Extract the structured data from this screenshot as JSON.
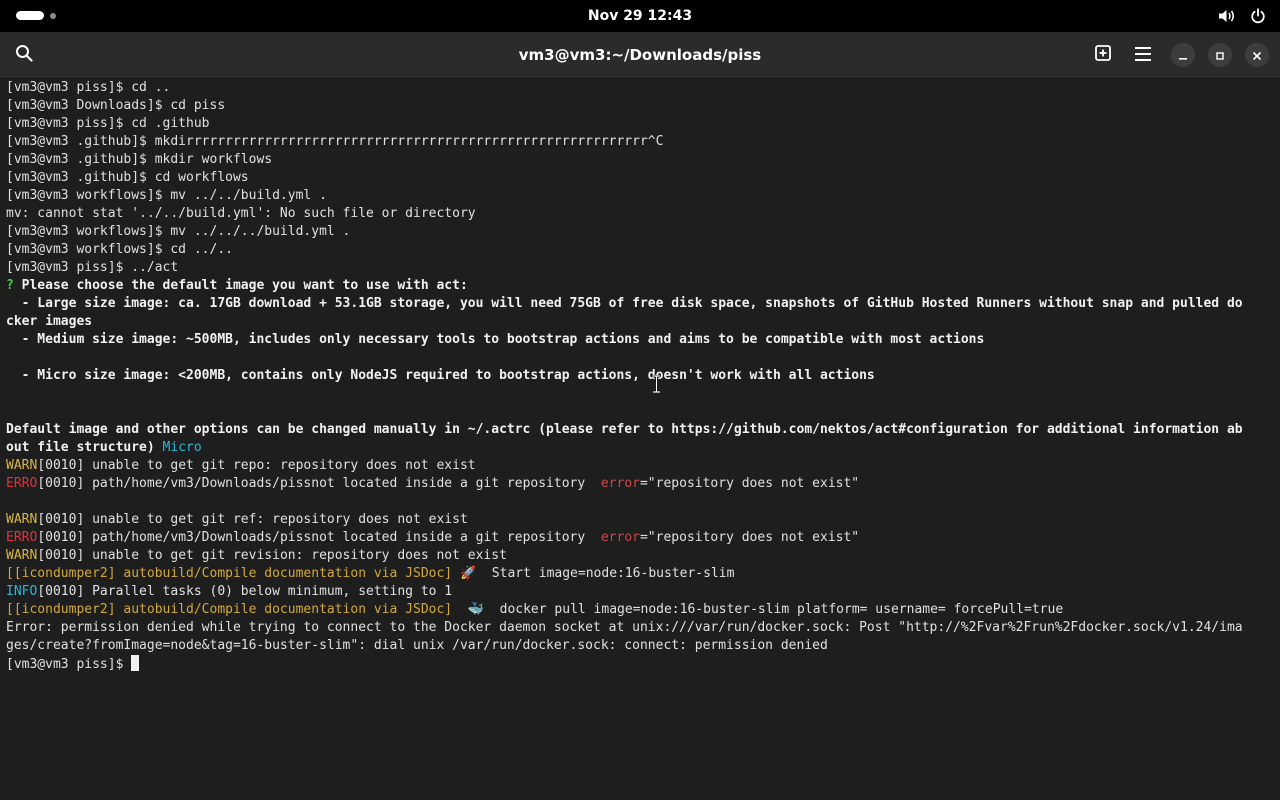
{
  "topbar": {
    "datetime": "Nov 29  12:43",
    "icons": [
      "activities-indicator",
      "volume-icon",
      "power-icon"
    ]
  },
  "window": {
    "title": "vm3@vm3:~/Downloads/piss",
    "icons": [
      "search-icon",
      "new-tab-icon",
      "menu-icon",
      "minimize-icon",
      "maximize-icon",
      "close-icon"
    ]
  },
  "terminal": {
    "l1": "[vm3@vm3 piss]$ cd ..",
    "l2": "[vm3@vm3 Downloads]$ cd piss",
    "l3": "[vm3@vm3 piss]$ cd .github",
    "l4": "[vm3@vm3 .github]$ mkdirrrrrrrrrrrrrrrrrrrrrrrrrrrrrrrrrrrrrrrrrrrrrrrrrrrrrrrrrrr^C",
    "l5": "[vm3@vm3 .github]$ mkdir workflows",
    "l6": "[vm3@vm3 .github]$ cd workflows",
    "l7": "[vm3@vm3 workflows]$ mv ../../build.yml .",
    "l8": "mv: cannot stat '../../build.yml': No such file or directory",
    "l9": "[vm3@vm3 workflows]$ mv ../../../build.yml .",
    "l10": "[vm3@vm3 workflows]$ cd ../..",
    "l11": "[vm3@vm3 piss]$ ../act",
    "l12_mark": "?",
    "l12": " Please choose the default image you want to use with act:",
    "l13": "  - Large size image: ca. 17GB download + 53.1GB storage, you will need 75GB of free disk space, snapshots of GitHub Hosted Runners without snap and pulled do",
    "l14": "cker images",
    "l15": "  - Medium size image: ~500MB, includes only necessary tools to bootstrap actions and aims to be compatible with most actions",
    "l17": "  - Micro size image: <200MB, contains only NodeJS required to bootstrap actions, doesn't work with all actions",
    "l20": "Default image and other options can be changed manually in ~/.actrc (please refer to https://github.com/nektos/act#configuration for additional information ab",
    "l21": "out file structure)",
    "l21_choice": " Micro",
    "warn_tag": "WARN",
    "erro_tag": "ERRO",
    "info_tag": "INFO",
    "l22": "[0010] unable to get git repo: repository does not exist",
    "l23a": "[0010] path/home/vm3/Downloads/pissnot located inside a git repository  ",
    "error_key": "error",
    "l23b": "=\"repository does not exist\"",
    "l25": "[0010] unable to get git ref: repository does not exist",
    "l26a": "[0010] path/home/vm3/Downloads/pissnot located inside a git repository  ",
    "l26b": "=\"repository does not exist\"",
    "l27": "[0010] unable to get git revision: repository does not exist",
    "job": "[[icondumper2] autobuild/Compile documentation via JSDoc]",
    "l28_icon": " 🚀 ",
    "l28": " Start image=node:16-buster-slim",
    "l29": "[0010] Parallel tasks (0) below minimum, setting to 1",
    "l30_icon": "  🐳 ",
    "l30": " docker pull image=node:16-buster-slim platform= username= forcePull=true",
    "l31": "Error: permission denied while trying to connect to the Docker daemon socket at unix:///var/run/docker.sock: Post \"http://%2Fvar%2Frun%2Fdocker.sock/v1.24/ima",
    "l32": "ges/create?fromImage=node&tag=16-buster-slim\": dial unix /var/run/docker.sock: connect: permission denied",
    "l33": "[vm3@vm3 piss]$ "
  }
}
